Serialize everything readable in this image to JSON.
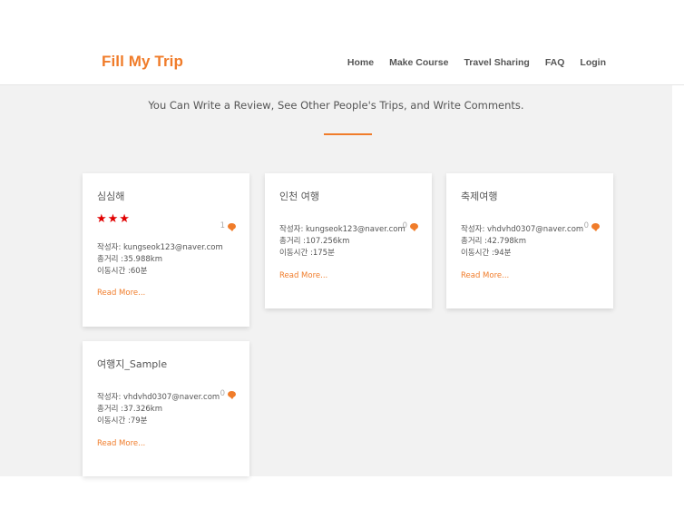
{
  "brand": {
    "logo": "Fill My Trip",
    "accent_color": "#f07c2a"
  },
  "nav": {
    "items": [
      "Home",
      "Make Course",
      "Travel Sharing",
      "FAQ",
      "Login"
    ]
  },
  "main": {
    "tagline": "You Can Write a Review, See Other People's Trips, and Write Comments."
  },
  "cards": [
    {
      "title": "심심해",
      "stars": "★★★",
      "rating": 3,
      "comments": "1",
      "author": "작성자:  kungseok123@naver.com",
      "distance": "총거리 :35.988km",
      "time": "이동시간 :60분",
      "read_more": "Read More..."
    },
    {
      "title": "인천 여행",
      "comments": "0",
      "author": "작성자:  kungseok123@naver.com",
      "distance": "총거리 :107.256km",
      "time": "이동시간 :175분",
      "read_more": "Read More..."
    },
    {
      "title": "축제여행",
      "comments": "0",
      "author": "작성자:  vhdvhd0307@naver.com",
      "distance": "총거리 :42.798km",
      "time": "이동시간 :94분",
      "read_more": "Read More..."
    },
    {
      "title": "여행지_Sample",
      "comments": "0",
      "author": "작성자:  vhdvhd0307@naver.com",
      "distance": "총거리 :37.326km",
      "time": "이동시간 :79분",
      "read_more": "Read More..."
    }
  ],
  "icons": {
    "comment": "speech-bubble-icon",
    "rating": "star-icon"
  }
}
